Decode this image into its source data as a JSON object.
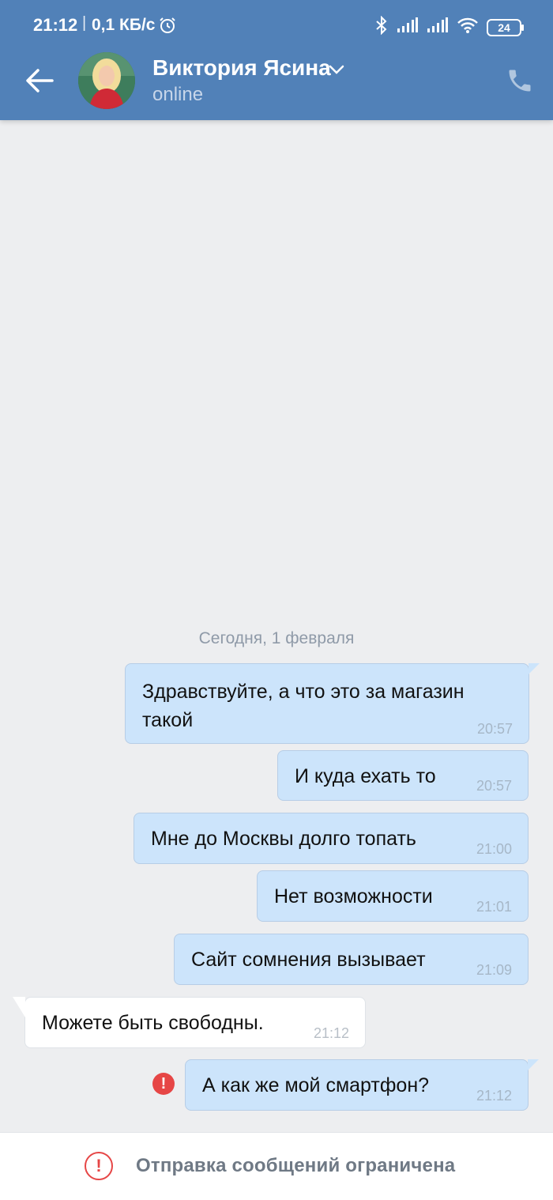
{
  "status_bar": {
    "time": "21:12",
    "separator": "|",
    "speed": "0,1 КБ/с",
    "battery": "24",
    "icons": [
      "alarm-icon",
      "bluetooth-icon",
      "signal-icon",
      "signal-icon",
      "wifi-icon",
      "battery-icon"
    ]
  },
  "header": {
    "contact_name": "Виктория Ясина",
    "contact_status": "online",
    "colors": {
      "background": "#5181b8",
      "text": "#ffffff"
    }
  },
  "chat": {
    "date_divider": "Сегодня, 1 февраля",
    "messages": [
      {
        "direction": "out",
        "text_line1": "Здравствуйте, а что это за магазин",
        "text_line2": "такой",
        "time": "20:57"
      },
      {
        "direction": "out",
        "text": "И куда ехать  то",
        "time": "20:57"
      },
      {
        "direction": "out",
        "text": "Мне до Москвы долго топать",
        "time": "21:00"
      },
      {
        "direction": "out",
        "text": "Нет возможности",
        "time": "21:01"
      },
      {
        "direction": "out",
        "text": "Сайт сомнения вызывает",
        "time": "21:09"
      },
      {
        "direction": "in",
        "text": "Можете быть свободны.",
        "time": "21:12"
      },
      {
        "direction": "out",
        "text": "А как же мой смартфон?",
        "time": "21:12",
        "error": true
      }
    ],
    "colors": {
      "outgoing_bubble": "#cce4fb",
      "incoming_bubble": "#ffffff",
      "error": "#e64646"
    }
  },
  "bottom_bar": {
    "restriction_text": "Отправка сообщений ограничена"
  }
}
